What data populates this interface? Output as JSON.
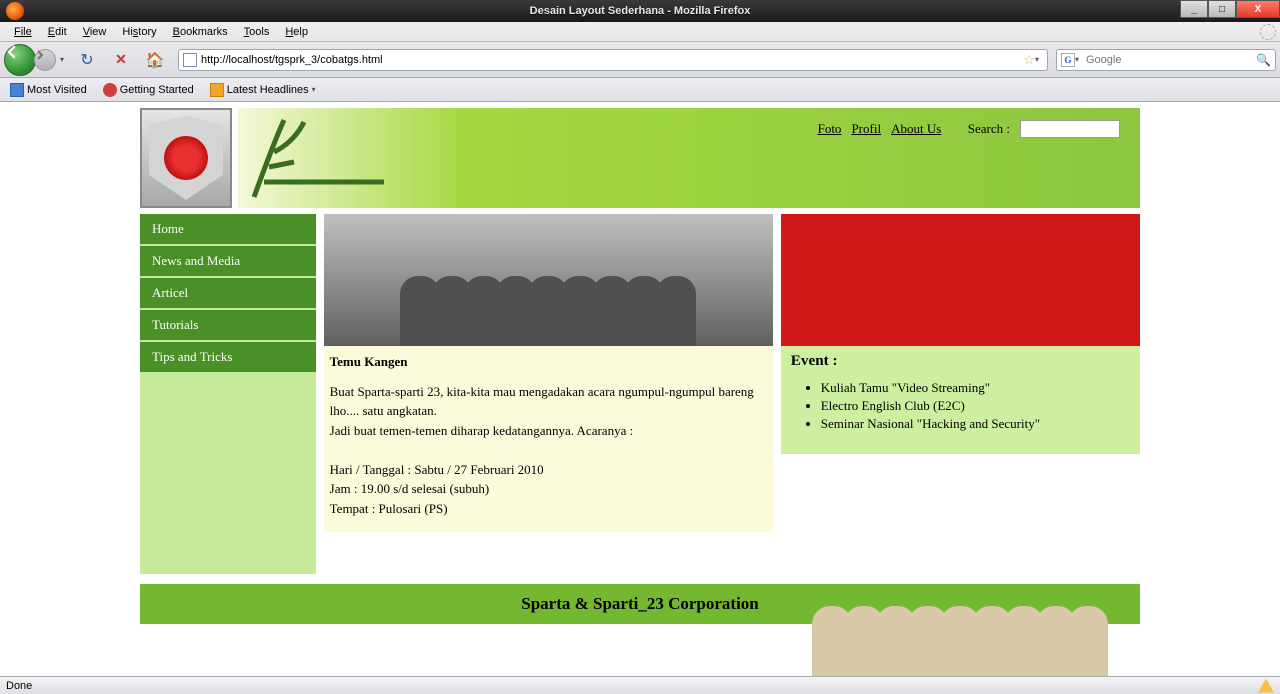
{
  "window": {
    "title": "Desain Layout Sederhana - Mozilla Firefox"
  },
  "menus": {
    "file": "File",
    "edit": "Edit",
    "view": "View",
    "history": "History",
    "bookmarks": "Bookmarks",
    "tools": "Tools",
    "help": "Help"
  },
  "address": {
    "url": "http://localhost/tgsprk_3/cobatgs.html"
  },
  "searchbox": {
    "placeholder": "Google"
  },
  "bookmarks_bar": {
    "most_visited": "Most Visited",
    "getting_started": "Getting Started",
    "latest_headlines": "Latest Headlines"
  },
  "page": {
    "header_links": {
      "foto": "Foto",
      "profil": "Profil",
      "about": "About Us",
      "search_label": "Search :"
    },
    "sidebar": {
      "items": [
        "Home",
        "News and Media",
        "Articel",
        "Tutorials",
        "Tips and Tricks"
      ]
    },
    "article": {
      "title": "Temu Kangen",
      "p1": "Buat Sparta-sparti 23, kita-kita mau mengadakan acara ngumpul-ngumpul bareng lho.... satu angkatan.",
      "p2": "Jadi buat temen-temen diharap kedatangannya. Acaranya :",
      "date": "Hari / Tanggal : Sabtu / 27 Februari 2010",
      "time": "Jam : 19.00 s/d selesai (subuh)",
      "place": "Tempat : Pulosari (PS)"
    },
    "events": {
      "title": "Event :",
      "items": [
        "Kuliah Tamu \"Video Streaming\"",
        "Electro English Club (E2C)",
        "Seminar Nasional \"Hacking and Security\""
      ]
    },
    "footer": "Sparta & Sparti_23 Corporation"
  },
  "status": {
    "text": "Done"
  }
}
